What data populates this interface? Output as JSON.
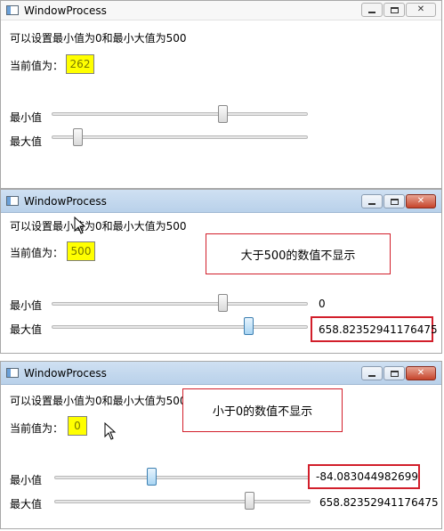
{
  "windows": [
    {
      "title": "WindowProcess",
      "description": "可以设置最小值为0和最小大值为500",
      "current_label": "当前值为：",
      "current_value": "262",
      "min_label": "最小值",
      "max_label": "最大值",
      "min_value_text": "",
      "max_value_text": ""
    },
    {
      "title": "WindowProcess",
      "description": "可以设置最小值为0和最小大值为500",
      "current_label": "当前值为：",
      "current_value": "500",
      "min_label": "最小值",
      "max_label": "最大值",
      "min_value_text": "0",
      "max_value_text": "658.82352941176475",
      "annotation": "大于500的数值不显示"
    },
    {
      "title": "WindowProcess",
      "description": "可以设置最小值为0和最小大值为500",
      "current_label": "当前值为：",
      "current_value": "0",
      "min_label": "最小值",
      "max_label": "最大值",
      "min_value_text": "-84.083044982699",
      "max_value_text": "658.82352941176475",
      "annotation": "小于0的数值不显示"
    }
  ],
  "icons": {
    "window_icon": "window-app-icon",
    "minimize": "minimize-icon",
    "maximize": "maximize-icon",
    "close": "close-icon",
    "cursor": "mouse-pointer-icon"
  }
}
